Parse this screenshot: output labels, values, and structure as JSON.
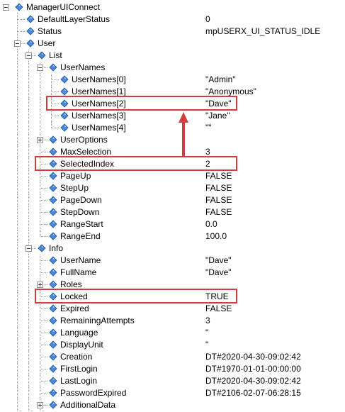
{
  "rows": [
    {
      "label": "ManagerUIConnect",
      "value": "",
      "level": 0,
      "expander": "minus"
    },
    {
      "label": "DefaultLayerStatus",
      "value": "0",
      "level": 1,
      "expander": ""
    },
    {
      "label": "Status",
      "value": "mpUSERX_UI_STATUS_IDLE",
      "level": 1,
      "expander": ""
    },
    {
      "label": "User",
      "value": "",
      "level": 1,
      "expander": "minus"
    },
    {
      "label": "List",
      "value": "",
      "level": 2,
      "expander": "minus"
    },
    {
      "label": "UserNames",
      "value": "",
      "level": 3,
      "expander": "minus"
    },
    {
      "label": "UserNames[0]",
      "value": "\"Admin\"",
      "level": 4,
      "expander": ""
    },
    {
      "label": "UserNames[1]",
      "value": "\"Anonymous\"",
      "level": 4,
      "expander": ""
    },
    {
      "label": "UserNames[2]",
      "value": "\"Dave\"",
      "level": 4,
      "expander": ""
    },
    {
      "label": "UserNames[3]",
      "value": "\"Jane\"",
      "level": 4,
      "expander": ""
    },
    {
      "label": "UserNames[4]",
      "value": "\"\"",
      "level": 4,
      "expander": ""
    },
    {
      "label": "UserOptions",
      "value": "",
      "level": 3,
      "expander": "plus"
    },
    {
      "label": "MaxSelection",
      "value": "3",
      "level": 3,
      "expander": ""
    },
    {
      "label": "SelectedIndex",
      "value": "2",
      "level": 3,
      "expander": ""
    },
    {
      "label": "PageUp",
      "value": "FALSE",
      "level": 3,
      "expander": ""
    },
    {
      "label": "StepUp",
      "value": "FALSE",
      "level": 3,
      "expander": ""
    },
    {
      "label": "PageDown",
      "value": "FALSE",
      "level": 3,
      "expander": ""
    },
    {
      "label": "StepDown",
      "value": "FALSE",
      "level": 3,
      "expander": ""
    },
    {
      "label": "RangeStart",
      "value": "0.0",
      "level": 3,
      "expander": ""
    },
    {
      "label": "RangeEnd",
      "value": "100.0",
      "level": 3,
      "expander": ""
    },
    {
      "label": "Info",
      "value": "",
      "level": 2,
      "expander": "minus"
    },
    {
      "label": "UserName",
      "value": "\"Dave\"",
      "level": 3,
      "expander": ""
    },
    {
      "label": "FullName",
      "value": "\"Dave\"",
      "level": 3,
      "expander": ""
    },
    {
      "label": "Roles",
      "value": "",
      "level": 3,
      "expander": "plus"
    },
    {
      "label": "Locked",
      "value": "TRUE",
      "level": 3,
      "expander": ""
    },
    {
      "label": "Expired",
      "value": "FALSE",
      "level": 3,
      "expander": ""
    },
    {
      "label": "RemainingAttempts",
      "value": "3",
      "level": 3,
      "expander": ""
    },
    {
      "label": "Language",
      "value": "\"",
      "level": 3,
      "expander": ""
    },
    {
      "label": "DisplayUnit",
      "value": "\"",
      "level": 3,
      "expander": ""
    },
    {
      "label": "Creation",
      "value": "DT#2020-04-30-09:02:42",
      "level": 3,
      "expander": ""
    },
    {
      "label": "FirstLogin",
      "value": "DT#1970-01-01-00:00:00",
      "level": 3,
      "expander": ""
    },
    {
      "label": "LastLogin",
      "value": "DT#2020-04-30-09:02:42",
      "level": 3,
      "expander": ""
    },
    {
      "label": "PasswordExpired",
      "value": "DT#2106-02-07-06:28:15",
      "level": 3,
      "expander": ""
    },
    {
      "label": "AdditionalData",
      "value": "",
      "level": 3,
      "expander": "plus"
    }
  ],
  "highlighted_rows": [
    "UserNames[2]",
    "SelectedIndex",
    "Locked"
  ],
  "colors": {
    "highlight": "#d43d40",
    "icon_fill": "#4a88d8",
    "tree_lines": "#9a9a9a"
  },
  "icons": {
    "variable": "diamond-variable-icon",
    "expand": "plus-expander-icon",
    "collapse": "minus-expander-icon"
  }
}
